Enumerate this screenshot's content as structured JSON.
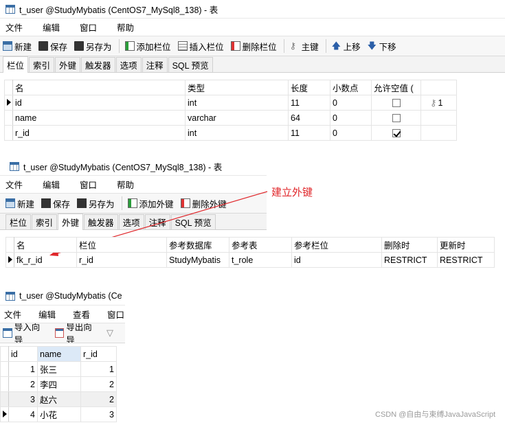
{
  "panel1": {
    "title": "t_user @StudyMybatis (CentOS7_MySql8_138) - 表",
    "menu": [
      "文件",
      "编辑",
      "窗口",
      "帮助"
    ],
    "toolbar": [
      "新建",
      "保存",
      "另存为",
      "添加栏位",
      "插入栏位",
      "删除栏位",
      "主键",
      "上移",
      "下移"
    ],
    "tabs": [
      "栏位",
      "索引",
      "外键",
      "触发器",
      "选项",
      "注释",
      "SQL 预览"
    ],
    "active_tab": "栏位",
    "columns": [
      "名",
      "类型",
      "长度",
      "小数点",
      "允许空值 (",
      ""
    ],
    "rows": [
      {
        "name": "id",
        "type": "int",
        "length": "11",
        "decimals": "0",
        "nullable": false,
        "key": "1"
      },
      {
        "name": "name",
        "type": "varchar",
        "length": "64",
        "decimals": "0",
        "nullable": false,
        "key": ""
      },
      {
        "name": "r_id",
        "type": "int",
        "length": "11",
        "decimals": "0",
        "nullable": true,
        "key": ""
      }
    ]
  },
  "panel2": {
    "title": "t_user @StudyMybatis (CentOS7_MySql8_138) - 表",
    "menu": [
      "文件",
      "编辑",
      "窗口",
      "帮助"
    ],
    "toolbar": [
      "新建",
      "保存",
      "另存为",
      "添加外键",
      "删除外键"
    ],
    "tabs": [
      "栏位",
      "索引",
      "外键",
      "触发器",
      "选项",
      "注释",
      "SQL 预览"
    ],
    "active_tab": "外键",
    "columns": [
      "名",
      "栏位",
      "参考数据库",
      "参考表",
      "参考栏位",
      "删除时",
      "更新时"
    ],
    "row": [
      "fk_r_id",
      "r_id",
      "StudyMybatis",
      "t_role",
      "id",
      "RESTRICT",
      "RESTRICT"
    ]
  },
  "annotation": "建立外键",
  "panel3": {
    "title": "t_user @StudyMybatis (Ce",
    "menu": [
      "文件",
      "编辑",
      "查看",
      "窗口"
    ],
    "toolbar": [
      "导入向导",
      "导出向导"
    ],
    "columns": [
      "id",
      "name",
      "r_id"
    ],
    "rows": [
      [
        "1",
        "张三",
        "1"
      ],
      [
        "2",
        "李四",
        "2"
      ],
      [
        "3",
        "赵六",
        "2"
      ],
      [
        "4",
        "小花",
        "3"
      ]
    ]
  },
  "watermark": "CSDN @自由与束缚JavaJavaScript",
  "colors": {
    "annotation": "#e0262a",
    "selected_header": "#dce9f7"
  }
}
